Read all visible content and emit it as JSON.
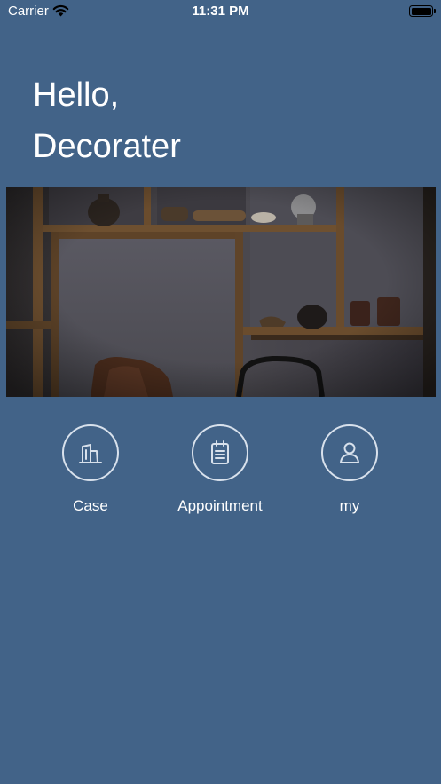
{
  "status_bar": {
    "carrier": "Carrier",
    "time": "11:31 PM",
    "icons": [
      "wifi-icon",
      "battery-icon"
    ]
  },
  "greeting": {
    "line1": "Hello,",
    "line2": "Decorater"
  },
  "banner": {
    "image": "interior shelf photo"
  },
  "menu": [
    {
      "label": "Case",
      "icon": "building-icon"
    },
    {
      "label": "Appointment",
      "icon": "clipboard-icon"
    },
    {
      "label": "my",
      "icon": "user-icon"
    }
  ],
  "colors": {
    "background": "#426388",
    "text": "#ffffff",
    "icon_stroke": "#d8e1ec"
  }
}
